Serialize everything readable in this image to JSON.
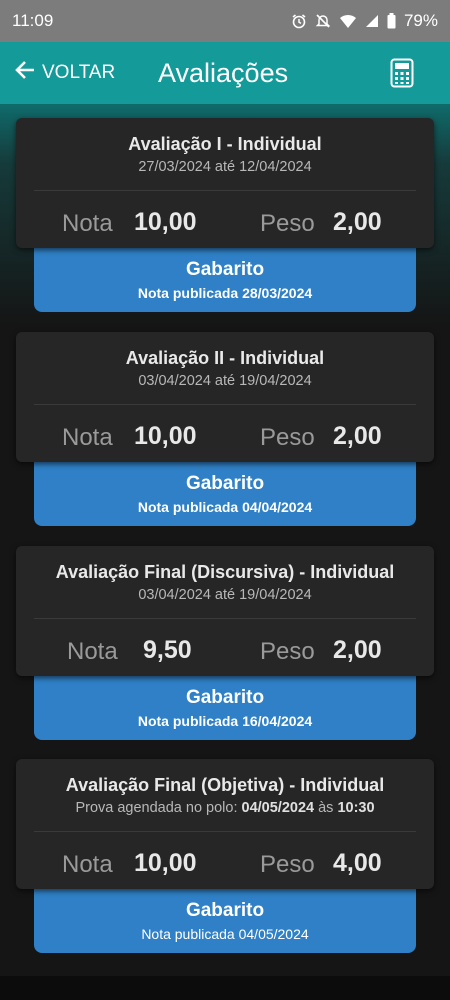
{
  "status": {
    "time": "11:09",
    "battery": "79%"
  },
  "header": {
    "back_label": "VOLTAR",
    "title": "Avaliações"
  },
  "cards": [
    {
      "title": "Avaliação I - Individual",
      "date_text": "27/03/2024 até 12/04/2024",
      "nota_label": "Nota",
      "nota": "10,00",
      "peso_label": "Peso",
      "peso": "2,00",
      "gabarito": "Gabarito",
      "publicada": "Nota publicada 28/03/2024"
    },
    {
      "title": "Avaliação II - Individual",
      "date_text": "03/04/2024 até 19/04/2024",
      "nota_label": "Nota",
      "nota": "10,00",
      "peso_label": "Peso",
      "peso": "2,00",
      "gabarito": "Gabarito",
      "publicada": "Nota publicada 04/04/2024"
    },
    {
      "title": "Avaliação Final (Discursiva) - Individual",
      "date_text": "03/04/2024 até 19/04/2024",
      "nota_label": "Nota",
      "nota": "9,50",
      "peso_label": "Peso",
      "peso": "2,00",
      "gabarito": "Gabarito",
      "publicada": "Nota publicada 16/04/2024"
    },
    {
      "title": "Avaliação Final (Objetiva) - Individual",
      "date_prefix": "Prova agendada no polo: ",
      "date_value": "04/05/2024",
      "date_mid": " às ",
      "time_value": "10:30",
      "nota_label": "Nota",
      "nota": "10,00",
      "peso_label": "Peso",
      "peso": "4,00",
      "gabarito": "Gabarito",
      "publicada": "Nota publicada 04/05/2024"
    }
  ]
}
